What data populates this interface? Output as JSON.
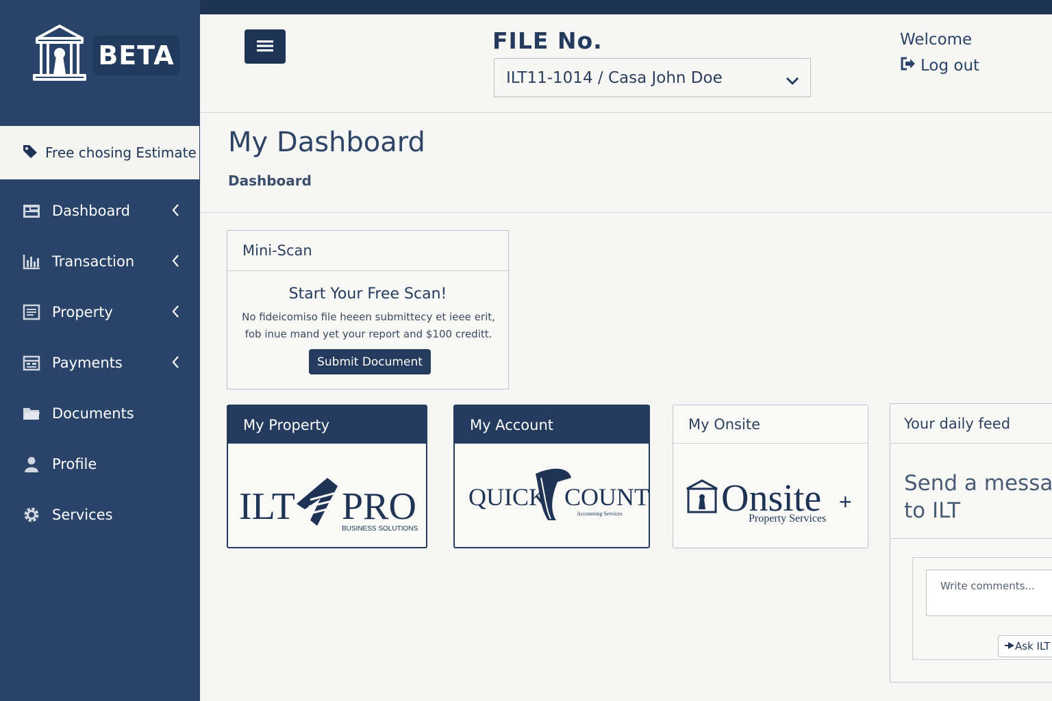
{
  "brand": {
    "badge": "BETA",
    "logo_icon": "building-lock-icon"
  },
  "sidebar": {
    "estimate": {
      "label": "Free chosing Estimate",
      "icon": "tag-icon"
    },
    "items": [
      {
        "label": "Dashboard",
        "icon": "dashboard-icon",
        "has_chevron": true
      },
      {
        "label": "Transaction",
        "icon": "bar-chart-icon",
        "has_chevron": true
      },
      {
        "label": "Property",
        "icon": "list-icon",
        "has_chevron": true
      },
      {
        "label": "Payments",
        "icon": "calendar-icon",
        "has_chevron": true
      },
      {
        "label": "Documents",
        "icon": "folder-icon",
        "has_chevron": false
      },
      {
        "label": "Profile",
        "icon": "user-icon",
        "has_chevron": false
      },
      {
        "label": "Services",
        "icon": "gear-icon",
        "has_chevron": false
      }
    ]
  },
  "header": {
    "menu_icon": "hamburger-icon",
    "file_label": "FILE No.",
    "file_value": "ILT11-1014 / Casa John Doe",
    "welcome": "Welcome",
    "logout": "Log out"
  },
  "page": {
    "title": "My Dashboard",
    "breadcrumb": "Dashboard"
  },
  "mini_scan": {
    "header": "Mini-Scan",
    "title": "Start Your Free Scan!",
    "line1": "No fideicomiso file heeen submittecy et ieee erit,",
    "line2": "fob inue mand yet your report and $100 creditt.",
    "button": "Submit Document"
  },
  "cards": [
    {
      "header": "My Property",
      "logo_main_left": "ILT",
      "logo_main_right": "PRO",
      "logo_sub": "BUSINESS SOLUTIONS"
    },
    {
      "header": "My Account",
      "logo_main_left": "QUICK",
      "logo_main_right": "COUNT",
      "logo_sub": "Accounting Services"
    },
    {
      "header": "My Onsite",
      "logo_main": "Onsite",
      "logo_plus": "+",
      "logo_sub": "Property Services"
    }
  ],
  "feed": {
    "header": "Your daily feed",
    "message_line1": "Send a messag",
    "message_line2": "to ILT",
    "comment_placeholder": "Write comments...",
    "ask_button": "Ask ILT"
  },
  "colors": {
    "navy": "#243b5e",
    "sidebar": "#2a4469",
    "background": "#f6f6f4"
  }
}
